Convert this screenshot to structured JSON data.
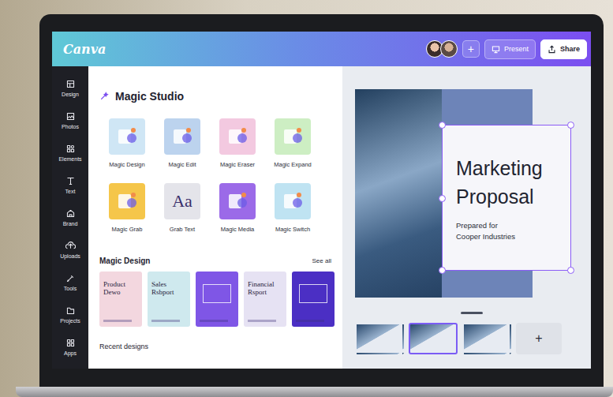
{
  "app": {
    "logo": "Canva"
  },
  "header": {
    "collaborators": 2,
    "add_icon": "+",
    "present_button": "Present",
    "share_button": "Share"
  },
  "sidebar": {
    "items": [
      {
        "label": "Design"
      },
      {
        "label": "Photos"
      },
      {
        "label": "Elements"
      },
      {
        "label": "Text"
      },
      {
        "label": "Brand"
      },
      {
        "label": "Uploads"
      },
      {
        "label": "Tools"
      },
      {
        "label": "Projects"
      },
      {
        "label": "Apps"
      }
    ]
  },
  "magic_studio": {
    "title": "Magic Studio",
    "tools": [
      {
        "label": "Magic Design",
        "color": "#cfe6f5"
      },
      {
        "label": "Magic Edit",
        "color": "#bcd3ee"
      },
      {
        "label": "Magic Eraser",
        "color": "#f3c9e0"
      },
      {
        "label": "Magic Expand",
        "color": "#cdeec3"
      },
      {
        "label": "Magic Grab",
        "color": "#f5c64a"
      },
      {
        "label": "Grab Text",
        "color": "#e4e4ea",
        "glyph": "Aa"
      },
      {
        "label": "Magic Media",
        "color": "#9b6ae8"
      },
      {
        "label": "Magic Switch",
        "color": "#bfe3f2"
      }
    ]
  },
  "magic_design": {
    "title": "Magic Design",
    "see_all": "See all",
    "templates": [
      {
        "title": "Product Dewo",
        "color": "#f3d7df"
      },
      {
        "title": "Sales Rsbport",
        "color": "#cfe9ee"
      },
      {
        "color": "#7f56e6"
      },
      {
        "title": "Financial Rsport",
        "color": "#e6e2f3"
      },
      {
        "color": "#4b2fc4"
      }
    ]
  },
  "recent": {
    "title": "Recent designs"
  },
  "slide": {
    "title": "Marketing Proposal",
    "subtitle": [
      "Prepared for",
      "Cooper Industries"
    ]
  },
  "pages": {
    "items": [
      {
        "selected": false
      },
      {
        "selected": true
      },
      {
        "selected": false
      }
    ],
    "add_icon": "+"
  }
}
